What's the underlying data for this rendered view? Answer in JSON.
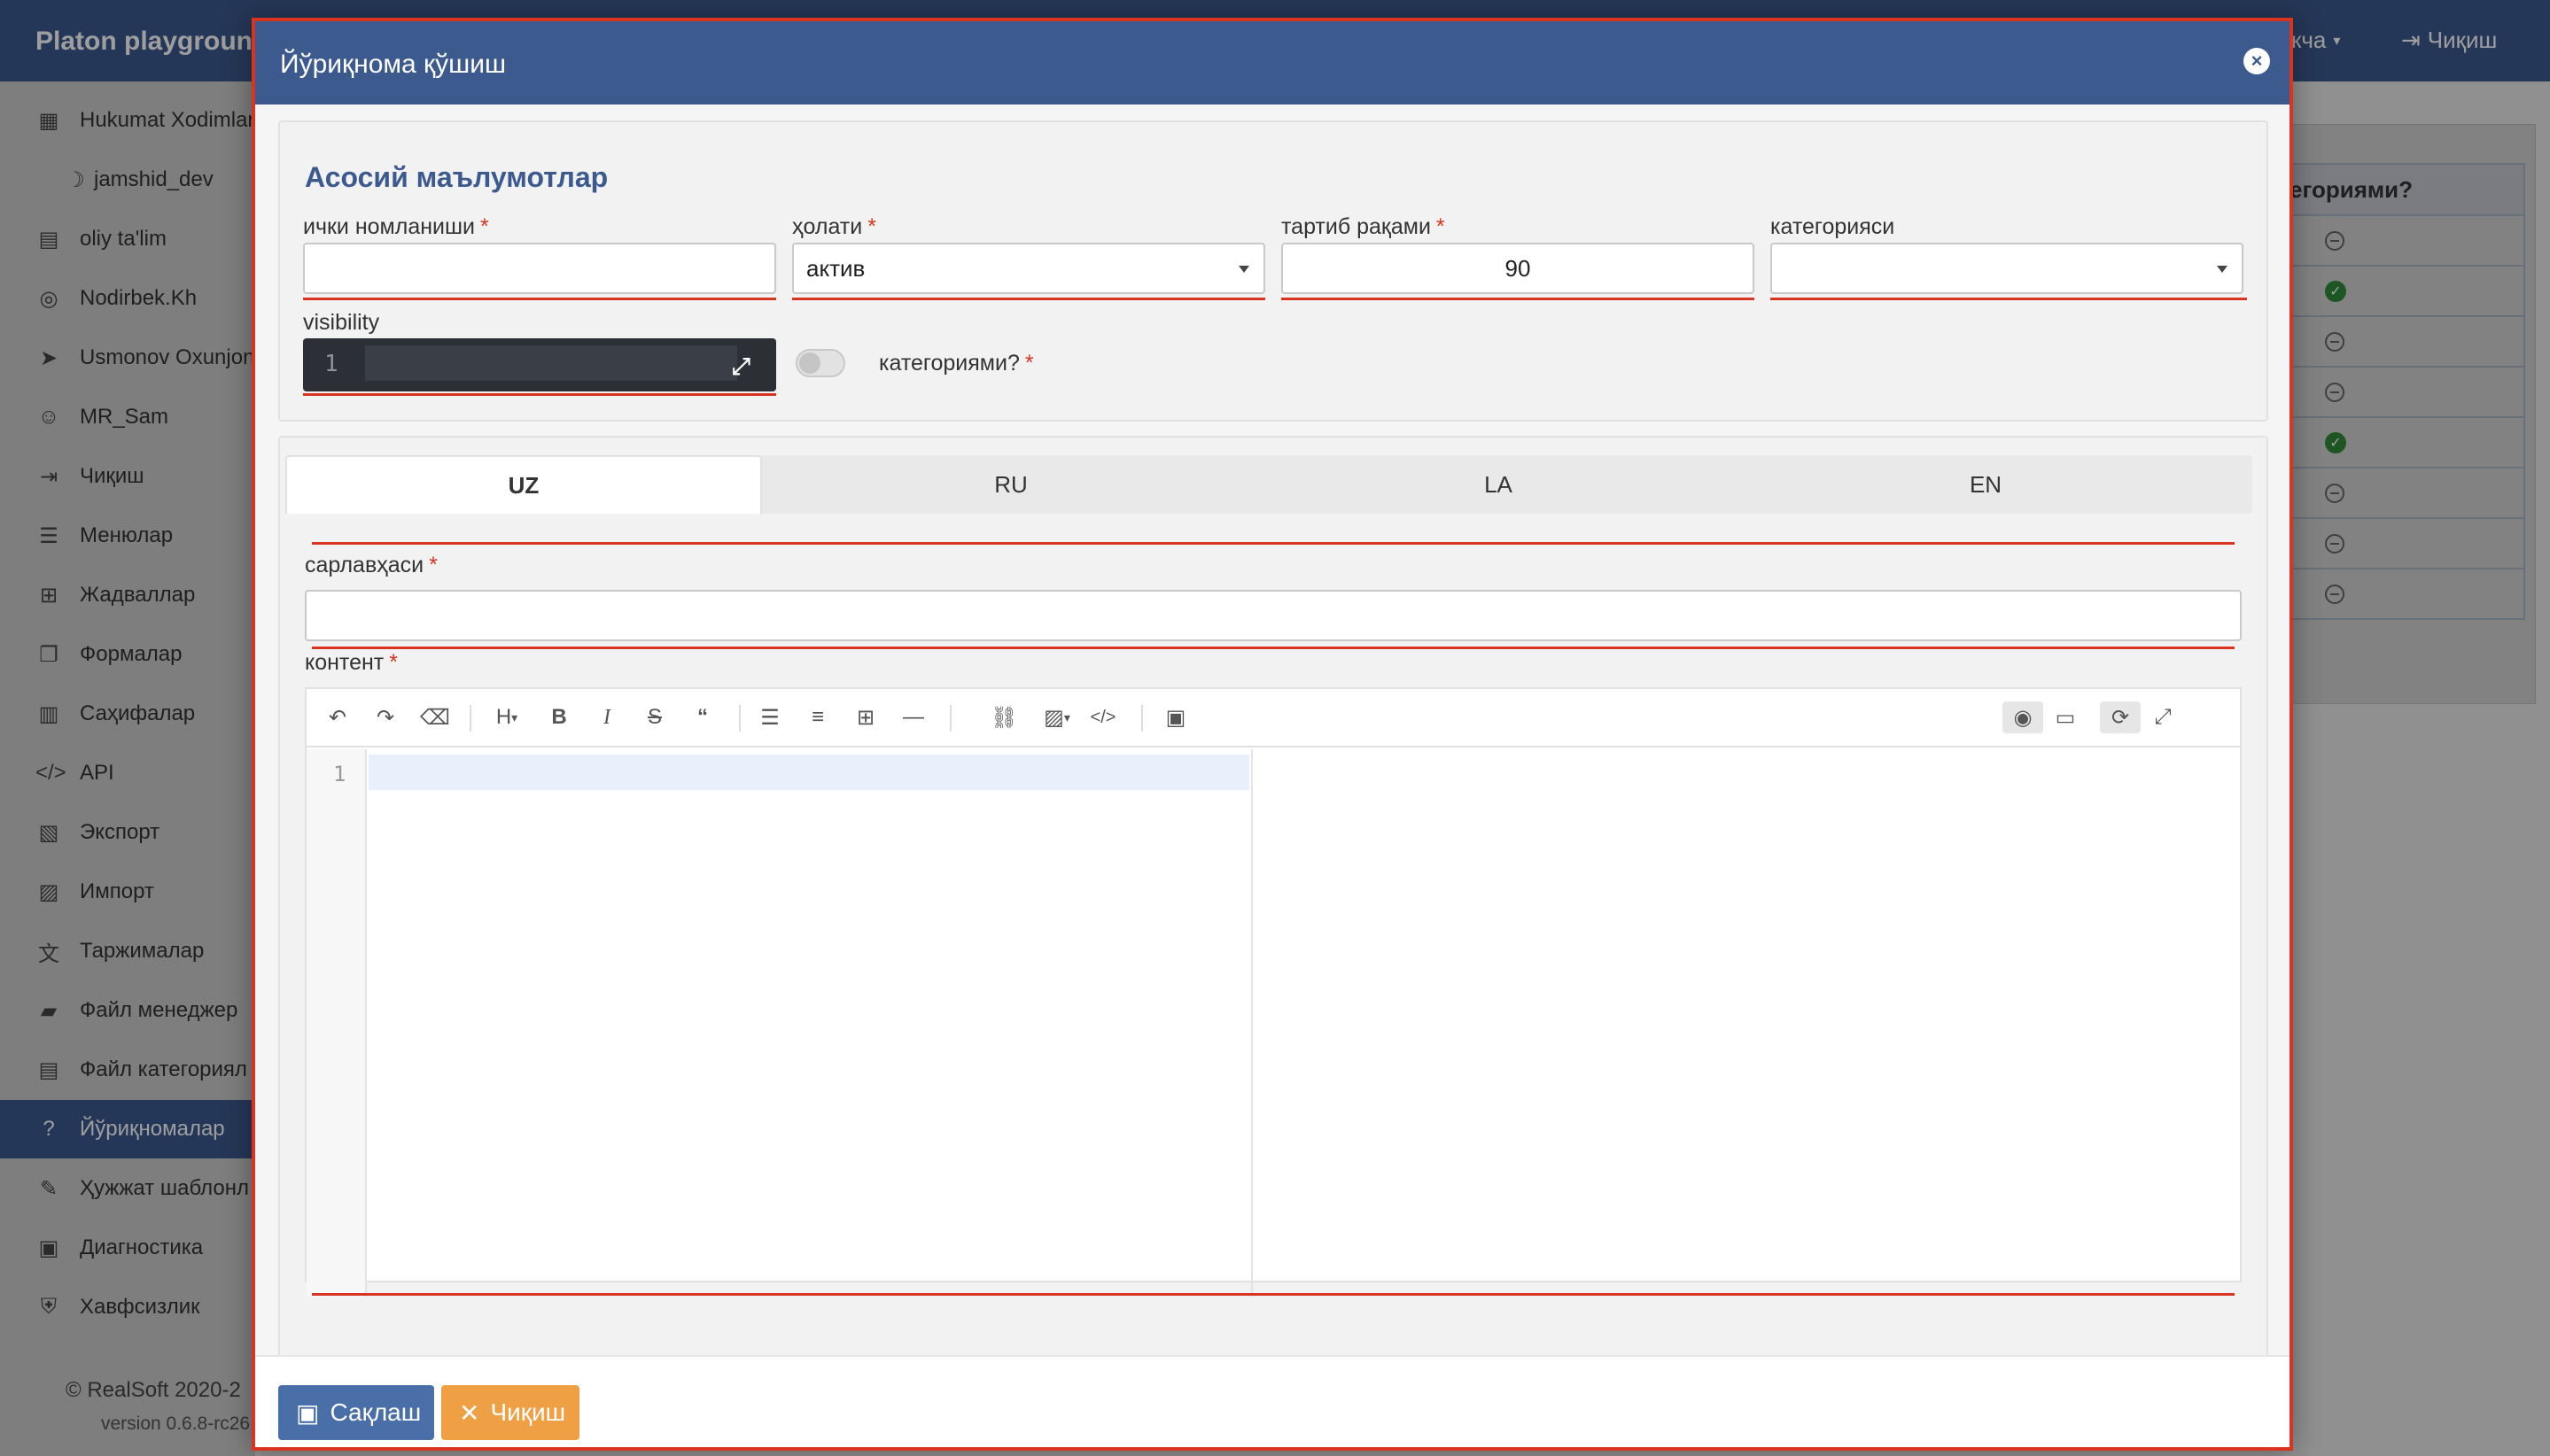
{
  "app": {
    "brand": "Platon playgroun",
    "lang_menu": "кча",
    "exit_label": "Чиқиш"
  },
  "sidebar": {
    "items": [
      {
        "label": "Hukumat Xodimlar",
        "icon": "building-icon"
      },
      {
        "label": "jamshid_dev",
        "icon": "moon-icon"
      },
      {
        "label": "oliy ta'lim",
        "icon": "file-icon"
      },
      {
        "label": "Nodirbek.Kh",
        "icon": "instagram-icon"
      },
      {
        "label": "Usmonov Oxunjon",
        "icon": "telegram-icon"
      },
      {
        "label": "MR_Sam",
        "icon": "headset-icon"
      },
      {
        "label": "Чиқиш",
        "icon": "sign-out-icon"
      },
      {
        "label": "Менюлар",
        "icon": "menu-icon"
      },
      {
        "label": "Жадваллар",
        "icon": "table-icon"
      },
      {
        "label": "Формалар",
        "icon": "forms-icon"
      },
      {
        "label": "Саҳифалар",
        "icon": "pages-icon"
      },
      {
        "label": "API",
        "icon": "code-icon"
      },
      {
        "label": "Экспорт",
        "icon": "export-icon"
      },
      {
        "label": "Импорт",
        "icon": "import-icon"
      },
      {
        "label": "Таржималар",
        "icon": "translate-icon"
      },
      {
        "label": "Файл менеджер",
        "icon": "folder-icon"
      },
      {
        "label": "Файл категориял",
        "icon": "file-category-icon"
      },
      {
        "label": "Йўриқномалар",
        "icon": "question-circle-icon"
      },
      {
        "label": "Ҳужжат шаблонл",
        "icon": "document-template-icon"
      },
      {
        "label": "Диагностика",
        "icon": "diagnostics-icon"
      },
      {
        "label": "Хавфсизлик",
        "icon": "shield-icon"
      }
    ],
    "copyright": "© RealSoft 2020-2",
    "version": "version 0.6.8-rc26"
  },
  "background_table": {
    "header": "егориями?",
    "rows": [
      "minus",
      "check",
      "minus",
      "minus",
      "check",
      "minus",
      "minus",
      "minus"
    ]
  },
  "modal": {
    "title": "Йўриқнома қўшиш",
    "section_title": "Асосий маълумотлар",
    "fields": {
      "internal_name": {
        "label": "ички номланиши",
        "value": ""
      },
      "status": {
        "label": "ҳолати",
        "value": "актив"
      },
      "order": {
        "label": "тартиб рақами",
        "value": "90"
      },
      "category": {
        "label": "категорияси",
        "value": ""
      },
      "visibility": {
        "label": "visibility",
        "line": "1"
      },
      "has_categories": {
        "label": "категориями?"
      }
    },
    "tabs": [
      "UZ",
      "RU",
      "LA",
      "EN"
    ],
    "title_field": {
      "label": "сарлавҳаси",
      "value": ""
    },
    "content_field": {
      "label": "контент",
      "line": "1"
    },
    "toolbar_heading": "H",
    "buttons": {
      "save": "Сақлаш",
      "exit": "Чиқиш"
    }
  },
  "colors": {
    "primary": "#3c5a8e",
    "highlight": "#d9341f",
    "save": "#4a6fa8",
    "exit": "#f0a044"
  }
}
